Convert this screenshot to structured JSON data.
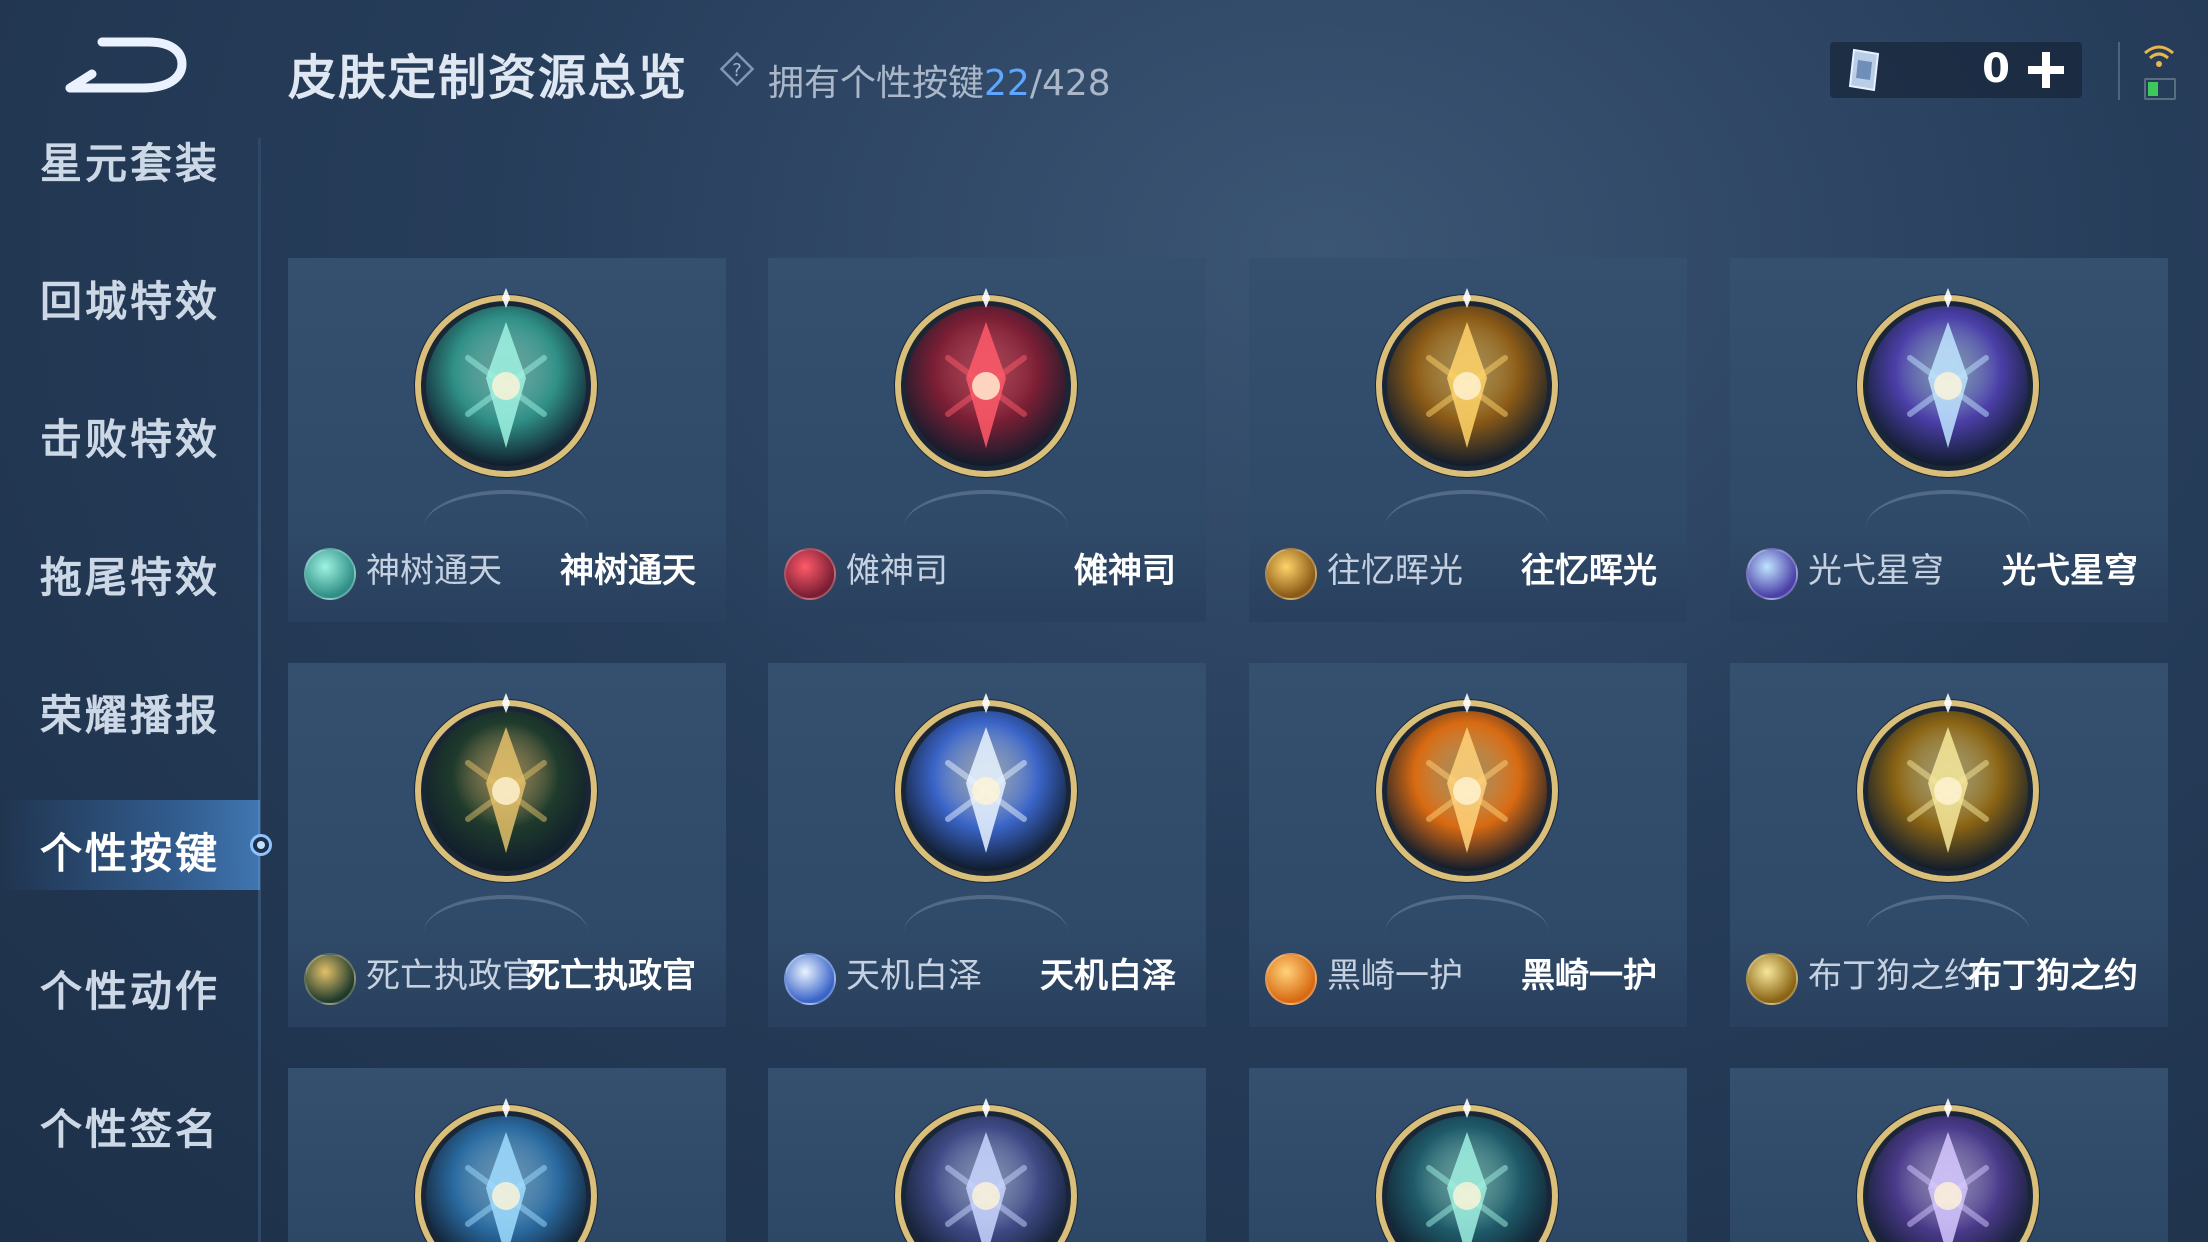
{
  "header": {
    "title": "皮肤定制资源总览",
    "owned_label": "拥有个性按键",
    "owned_count": "22",
    "owned_total": "/428",
    "currency_amount": "0"
  },
  "icons": [
    "back-arrow-icon",
    "help-diamond-icon",
    "gem-currency-icon",
    "plus-icon",
    "wifi-icon",
    "battery-icon"
  ],
  "sidebar": {
    "items": [
      {
        "label": "星元套装"
      },
      {
        "label": "回城特效"
      },
      {
        "label": "击败特效"
      },
      {
        "label": "拖尾特效"
      },
      {
        "label": "荣耀播报"
      },
      {
        "label": "个性按键",
        "active": true
      },
      {
        "label": "个性动作"
      },
      {
        "label": "个性签名"
      }
    ]
  },
  "cards": [
    {
      "hero": "神树通天",
      "skin": "神树通天",
      "theme": "#2f8f86",
      "accent": "#9ff2e2"
    },
    {
      "hero": "傩神司",
      "skin": "傩神司",
      "theme": "#7a1e34",
      "accent": "#ff5a6a"
    },
    {
      "hero": "往忆晖光",
      "skin": "往忆晖光",
      "theme": "#8a5a16",
      "accent": "#ffd36a"
    },
    {
      "hero": "光弋星穹",
      "skin": "光弋星穹",
      "theme": "#4b3fa8",
      "accent": "#bfe4ff"
    },
    {
      "hero": "死亡执政官",
      "skin": "死亡执政官",
      "theme": "#1f3b2c",
      "accent": "#e3c06a"
    },
    {
      "hero": "天机白泽",
      "skin": "天机白泽",
      "theme": "#3a64c8",
      "accent": "#e8f3ff"
    },
    {
      "hero": "黑崎一护",
      "skin": "黑崎一护",
      "theme": "#d86a12",
      "accent": "#ffd27a"
    },
    {
      "hero": "布丁狗之约",
      "skin": "布丁狗之约",
      "theme": "#8a6414",
      "accent": "#f6e79a"
    },
    {
      "hero": "",
      "skin": "",
      "theme": "#2a6aa0",
      "accent": "#9fdcff"
    },
    {
      "hero": "",
      "skin": "",
      "theme": "#3f4a86",
      "accent": "#c8d6ff"
    },
    {
      "hero": "",
      "skin": "",
      "theme": "#1f5b6a",
      "accent": "#9ff0e0"
    },
    {
      "hero": "",
      "skin": "",
      "theme": "#4a3a8a",
      "accent": "#d6c8ff"
    }
  ]
}
